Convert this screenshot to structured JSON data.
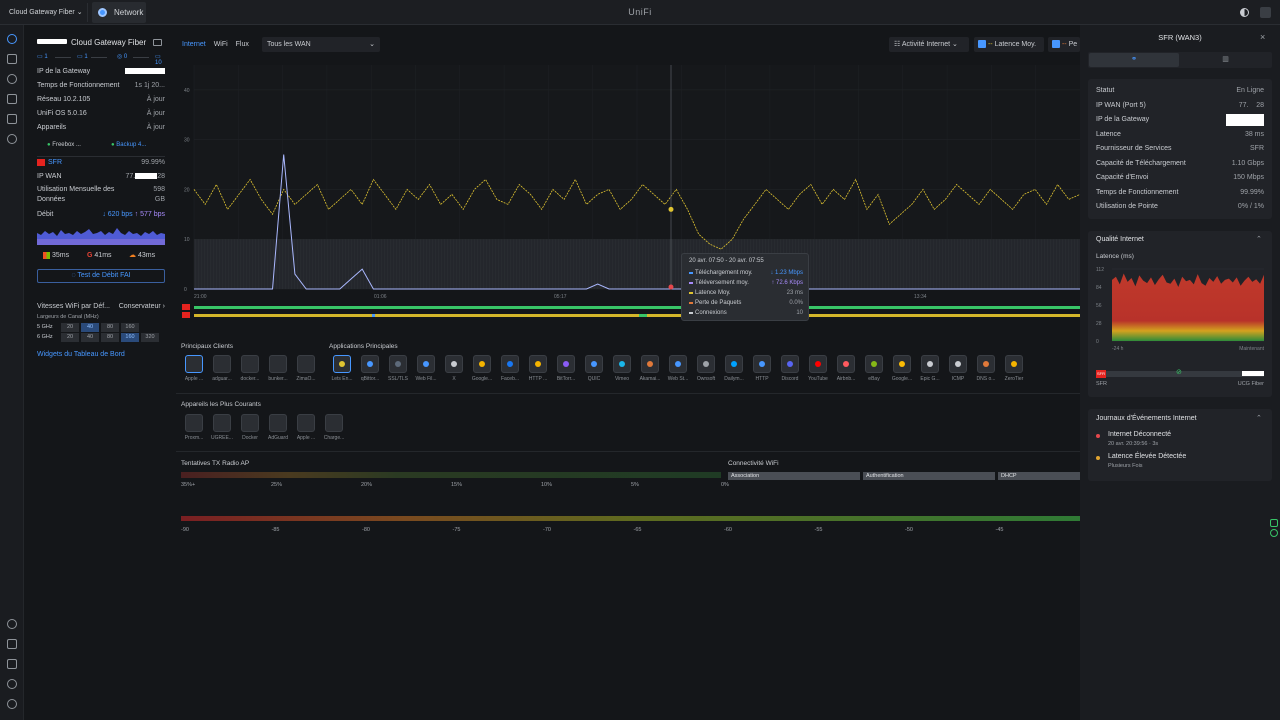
{
  "topbar": {
    "device": "Cloud Gateway Fiber",
    "app": "Network",
    "title": "UniFi"
  },
  "device": {
    "name": "Cloud Gateway Fiber",
    "ports": [
      "1",
      "1",
      "0",
      "10"
    ],
    "rows": [
      {
        "label": "IP de la Gateway",
        "value": ""
      },
      {
        "label": "Temps de Fonctionnement",
        "value": "1s 1j 20..."
      },
      {
        "label": "Réseau 10.2.105",
        "value": "À jour"
      },
      {
        "label": "UniFi OS 5.0.16",
        "value": "À jour"
      },
      {
        "label": "Appareils",
        "value": "À jour"
      }
    ],
    "apps": [
      "Freebox ...",
      "Backup 4..."
    ],
    "wan_name": "SFR",
    "wan_uptime": "99.99%",
    "ip_wan_label": "IP WAN",
    "ip_wan_prefix": "77.",
    "ip_wan_suffix": "28",
    "usage_label": "Utilisation Mensuelle des Données",
    "usage_value": "598 GB",
    "debit_label": "Débit",
    "down": "↓ 620 bps",
    "up": "↑ 577 bps",
    "latencies": [
      "35ms",
      "41ms",
      "43ms"
    ],
    "speedtest": "Test de Débit FAI",
    "wifi_title": "Vitesses WiFi par Déf...",
    "wifi_mode": "Conservateur",
    "channel_title": "Largeurs de Canal (MHz)",
    "band5": "5 GHz",
    "band5_vals": [
      "20",
      "40",
      "80",
      "160"
    ],
    "band6": "6 GHz",
    "band6_vals": [
      "20",
      "40",
      "80",
      "160",
      "320"
    ],
    "widgets": "Widgets du Tableau de Bord"
  },
  "main": {
    "tabs": [
      "Internet",
      "WiFi",
      "Flux"
    ],
    "wan_select": "Tous les WAN",
    "activity": "Activité Internet",
    "latency_toggle": "Latence Moy.",
    "pe": "Pe",
    "y_ticks": [
      "40",
      "30",
      "20",
      "10",
      "0"
    ],
    "x_ticks": [
      "21:00",
      "01:06",
      "05:17",
      "09:22",
      "13:34"
    ],
    "clients_title": "Principaux Clients",
    "clients": [
      "Apple ...",
      "adguar...",
      "docker...",
      "bunker...",
      "ZimaO..."
    ],
    "apps_title": "Applications Principales",
    "apps": [
      "Lets En...",
      "qBittor...",
      "SSL/TLS",
      "Web Fil...",
      "X",
      "Google...",
      "Faceb...",
      "HTTP ...",
      "BitTorr...",
      "QUIC",
      "Vimeo",
      "Akamai...",
      "Web St...",
      "Ownsoft",
      "Dailym...",
      "HTTP",
      "Discord",
      "YouTube",
      "Airbnb...",
      "eBay",
      "Google...",
      "Epic G...",
      "ICMP",
      "DNS o...",
      "ZeroTier"
    ],
    "frequent_title": "Appareils les Plus Courants",
    "frequent": [
      "Proxm...",
      "UGREE...",
      "Docker",
      "AdGuard",
      "Apple ...",
      "Charge..."
    ],
    "tx_title": "Tentatives TX Radio AP",
    "tx_ticks": [
      "35%+",
      "25%",
      "20%",
      "15%",
      "10%",
      "5%",
      "0%"
    ],
    "wifi_conn_title": "Connectivité WiFi",
    "wifi_conn": [
      "Association",
      "Authentification",
      "DHCP"
    ],
    "rssi_ticks": [
      "-90",
      "-85",
      "-80",
      "-75",
      "-70",
      "-65",
      "-60",
      "-55",
      "-50",
      "-45"
    ]
  },
  "tooltip": {
    "title": "20 avr. 07:50 - 20 avr. 07:55",
    "rows": [
      {
        "label": "Téléchargement moy.",
        "value": "↓ 1.23 Mbps",
        "color": "#4797ff"
      },
      {
        "label": "Téléversement moy.",
        "value": "↑ 72.6 Kbps",
        "color": "#a78bfa"
      },
      {
        "label": "Latence Moy.",
        "value": "23 ms",
        "color": "#e0c431"
      },
      {
        "label": "Perte de Paquets",
        "value": "0.0%",
        "color": "#e0793a"
      },
      {
        "label": "Connexions",
        "value": "10",
        "color": "#c9ccd1"
      }
    ]
  },
  "side": {
    "title": "SFR (WAN3)",
    "rows": [
      {
        "k": "Statut",
        "v": "En Ligne"
      },
      {
        "k": "IP WAN (Port 5)",
        "v": "77.    28"
      },
      {
        "k": "IP de la Gateway",
        "v": ""
      },
      {
        "k": "Latence",
        "v": "38 ms"
      },
      {
        "k": "Fournisseur de Services",
        "v": "SFR"
      },
      {
        "k": "Capacité de Téléchargement",
        "v": "1.10 Gbps"
      },
      {
        "k": "Capacité d'Envoi",
        "v": "150 Mbps"
      },
      {
        "k": "Temps de Fonctionnement",
        "v": "99.99%"
      },
      {
        "k": "Utilisation de Pointe",
        "v": "0% / 1%"
      }
    ],
    "quality_title": "Qualité Internet",
    "latency_label": "Latence (ms)",
    "lat_ticks": [
      "112",
      "84",
      "56",
      "28",
      "0"
    ],
    "lat_from": "-24 h",
    "lat_to": "Maintenant",
    "isp": "SFR",
    "gw": "UCG Fiber",
    "events_title": "Journaux d'Événements Internet",
    "events": [
      {
        "title": "Internet Déconnecté",
        "sub": "20 avr. 20:39:56 · 3s",
        "color": "#e5484d"
      },
      {
        "title": "Latence Élevée Détectée",
        "sub": "Plusieurs Fois",
        "color": "#e0a431"
      }
    ]
  },
  "chart_data": {
    "type": "line",
    "title": "",
    "x_ticks": [
      "21:00",
      "01:06",
      "05:17",
      "09:22",
      "13:34"
    ],
    "ylim": [
      0,
      45
    ],
    "series": [
      {
        "name": "Latence Moy.",
        "values": [
          20,
          17,
          21,
          16,
          19,
          22,
          18,
          15,
          20,
          17,
          19,
          21,
          16,
          18,
          20,
          17,
          22,
          19,
          16,
          20,
          18,
          21,
          17,
          19,
          16,
          20,
          22,
          18,
          17,
          21,
          19,
          16,
          20,
          18,
          22,
          17,
          19,
          20,
          16,
          18,
          21,
          19,
          17,
          20,
          16,
          11,
          9,
          8,
          10,
          14,
          17,
          20,
          18,
          16,
          19,
          21,
          17,
          20,
          18,
          22,
          16,
          19,
          13,
          15,
          17,
          20,
          16,
          18,
          21,
          19,
          17,
          20,
          18,
          16,
          19,
          20,
          17,
          21,
          18,
          19
        ]
      },
      {
        "name": "Téléchargement moy.",
        "values": [
          0,
          0,
          0,
          0,
          0,
          0,
          0,
          0,
          27,
          3,
          0,
          0,
          0,
          0,
          2,
          4,
          0,
          0,
          0,
          0,
          0,
          0,
          0,
          0,
          0,
          0,
          0,
          0,
          0,
          0,
          0,
          0,
          0,
          0,
          0,
          0,
          1,
          0,
          0,
          0,
          0,
          0,
          0,
          0,
          0,
          0,
          0,
          0,
          0,
          0,
          0,
          0,
          0,
          0,
          0,
          0,
          0,
          0,
          0,
          0,
          0,
          0,
          0,
          0,
          0,
          0,
          0,
          0,
          0,
          0,
          0,
          0,
          0,
          0,
          0,
          0,
          0,
          0,
          0,
          0
        ]
      }
    ]
  }
}
